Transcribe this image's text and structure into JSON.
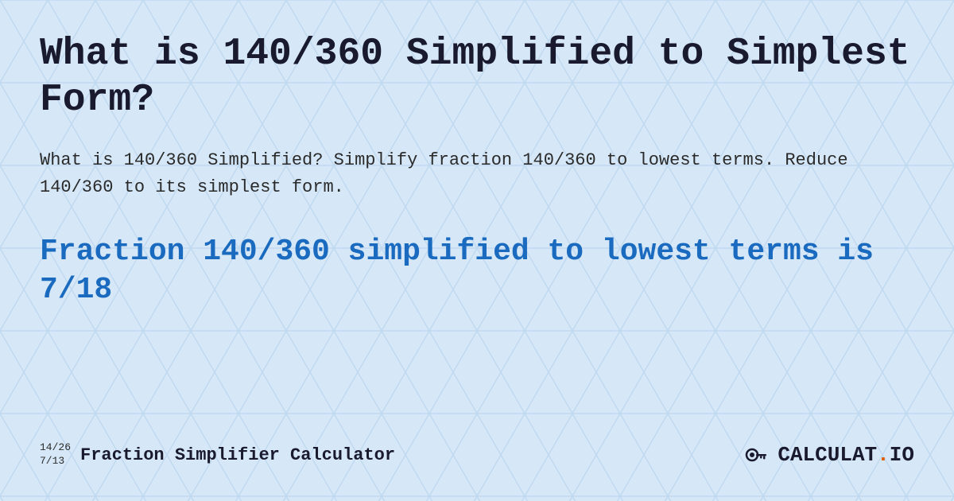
{
  "background": {
    "color": "#cde0f3"
  },
  "title": "What is 140/360 Simplified to Simplest Form?",
  "description": "What is 140/360 Simplified? Simplify fraction 140/360 to lowest terms. Reduce 140/360 to its simplest form.",
  "result": "Fraction 140/360 simplified to lowest terms is 7/18",
  "footer": {
    "fraction_top": "14/26",
    "fraction_bottom": "7/13",
    "brand_name": "Fraction Simplifier Calculator",
    "logo_text": "CALCULAT.IO"
  }
}
